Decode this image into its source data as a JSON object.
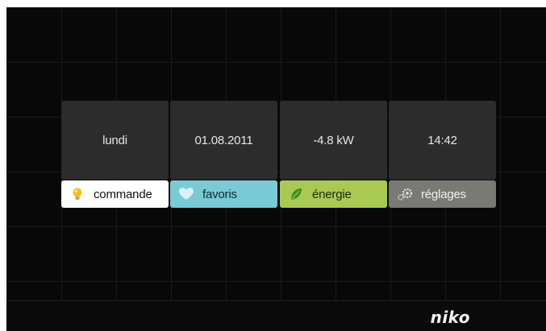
{
  "info_tiles": {
    "day": "lundi",
    "date": "01.08.2011",
    "power": "-4.8 kW",
    "time": "14:42"
  },
  "tabs": {
    "commande": {
      "label": "commande",
      "icon": "lightbulb-icon",
      "color": "#ffffff"
    },
    "favoris": {
      "label": "favoris",
      "icon": "heart-icon",
      "color": "#79cad4"
    },
    "energie": {
      "label": "énergie",
      "icon": "leaf-icon",
      "color": "#a9c955"
    },
    "reglages": {
      "label": "réglages",
      "icon": "gears-icon",
      "color": "#7a7a74"
    }
  },
  "footer": {
    "logo": "niko"
  }
}
